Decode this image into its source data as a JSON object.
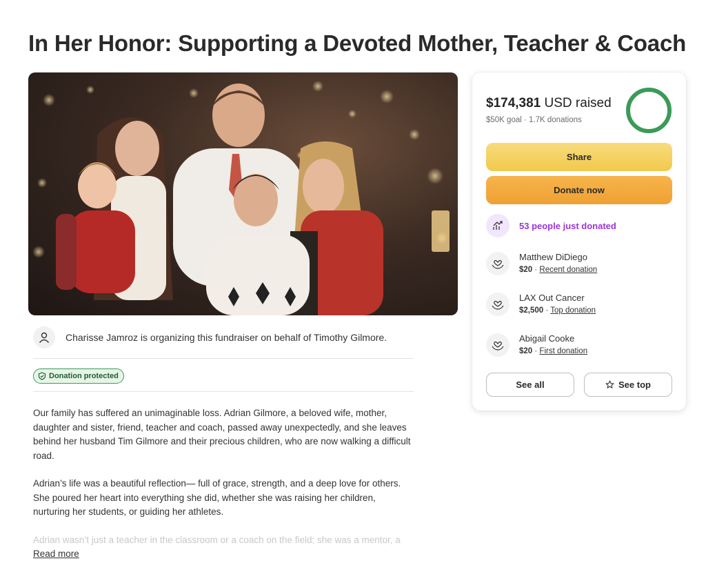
{
  "page": {
    "title": "In Her Honor: Supporting a Devoted Mother, Teacher & Coach"
  },
  "organizer": {
    "text": "Charisse Jamroz is organizing this fundraiser on behalf of Timothy Gilmore."
  },
  "badge": {
    "label": "Donation protected"
  },
  "story": {
    "paragraphs": [
      "Our family has suffered an unimaginable loss. Adrian Gilmore, a beloved wife, mother, daughter and sister, friend, teacher and coach, passed away unexpectedly, and she leaves behind her husband Tim Gilmore and their precious children, who are now walking a difficult road.",
      "Adrian’s life was a beautiful reflection— full of grace, strength, and a deep love for others. She poured her heart into everything she did, whether she was raising her children, nurturing her students, or guiding her athletes.",
      "Adrian wasn’t just a teacher in the classroom or a coach on the field; she was a mentor, a"
    ],
    "read_more": "Read more"
  },
  "donation": {
    "raised_amount": "$174,381",
    "raised_suffix": "USD raised",
    "goal": "$50K goal",
    "donations_count": "1.7K donations",
    "progress_fraction": 1.0,
    "share_label": "Share",
    "donate_label": "Donate now",
    "trend_text": "53 people just donated",
    "donors": [
      {
        "name": "Matthew DiDiego",
        "amount": "$20",
        "tag": "Recent donation"
      },
      {
        "name": "LAX Out Cancer",
        "amount": "$2,500",
        "tag": "Top donation"
      },
      {
        "name": "Abigail Cooke",
        "amount": "$20",
        "tag": "First donation"
      }
    ],
    "see_all_label": "See all",
    "see_top_label": "See top"
  },
  "colors": {
    "progress": "#3a9b57",
    "share": "#f2c94c",
    "donate": "#efa033",
    "trend": "#9b33d9",
    "badge_border": "#3e9a5a"
  }
}
